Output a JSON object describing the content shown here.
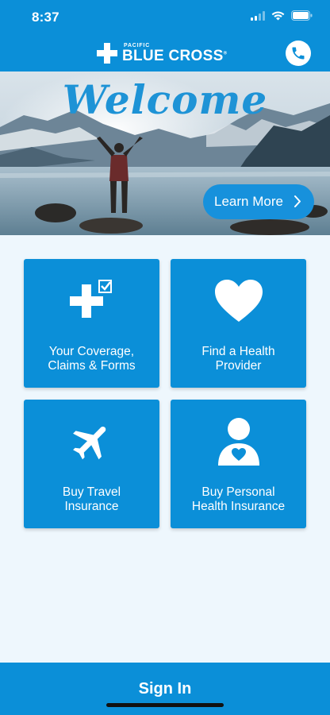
{
  "status_bar": {
    "time": "8:37"
  },
  "header": {
    "logo_small": "PACIFIC",
    "logo_big": "BLUE CROSS",
    "logo_reg": "®"
  },
  "hero": {
    "title": "Welcome",
    "learn_more_label": "Learn More"
  },
  "tiles": [
    {
      "line1": "Your Coverage,",
      "line2": "Claims & Forms",
      "icon": "cross-check-icon"
    },
    {
      "line1": "Find a Health",
      "line2": "Provider",
      "icon": "heart-icon"
    },
    {
      "line1": "Buy Travel",
      "line2": "Insurance",
      "icon": "airplane-icon"
    },
    {
      "line1": "Buy Personal",
      "line2": "Health Insurance",
      "icon": "person-heart-icon"
    }
  ],
  "footer": {
    "sign_in_label": "Sign In"
  },
  "colors": {
    "brand_blue": "#0b8fd8",
    "background": "#eef7fd"
  }
}
